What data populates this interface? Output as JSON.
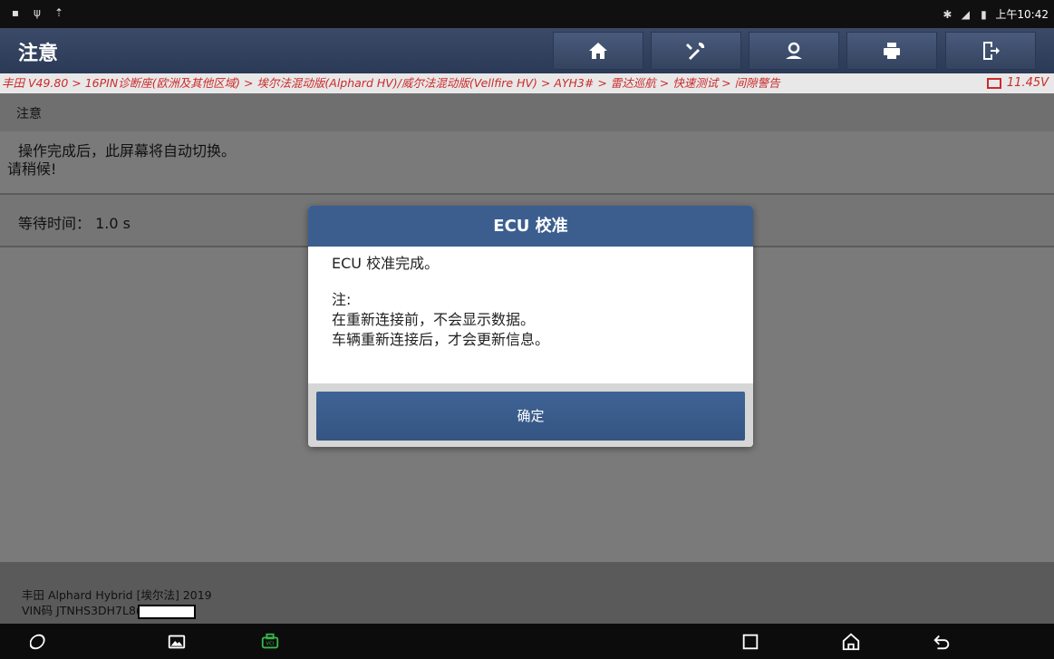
{
  "status_bar": {
    "time": "上午10:42"
  },
  "header": {
    "title": "注意",
    "buttons": [
      "home-icon",
      "tool-icon",
      "user-icon",
      "print-icon",
      "exit-icon"
    ]
  },
  "breadcrumb": {
    "path": "丰田 V49.80 > 16PIN诊断座(欧洲及其他区域) > 埃尔法混动版(Alphard HV)/威尔法混动版(Vellfire HV) > AYH3# > 雷达巡航 > 快速测试 > 间隙警告",
    "voltage": "11.45V"
  },
  "section": {
    "heading": "注意",
    "message_line1": "操作完成后，此屏幕将自动切换。",
    "message_line2": "请稍候!",
    "wait_label": "等待时间：",
    "wait_value": "1.0 s"
  },
  "vehicle": {
    "model": "丰田 Alphard Hybrid [埃尔法] 2019",
    "vin_label": "VIN码 JTNHS3DH7L8("
  },
  "modal": {
    "title": "ECU 校准",
    "line1": "ECU 校准完成。",
    "note_label": "注:",
    "note_line1": "在重新连接前，不会显示数据。",
    "note_line2": "车辆重新连接后，才会更新信息。",
    "ok_label": "确定"
  },
  "colors": {
    "header_bg": "#2b3a56",
    "accent": "#3b5e8f",
    "breadcrumb_text": "#cc2a2a",
    "vci_icon": "#39b54a"
  }
}
